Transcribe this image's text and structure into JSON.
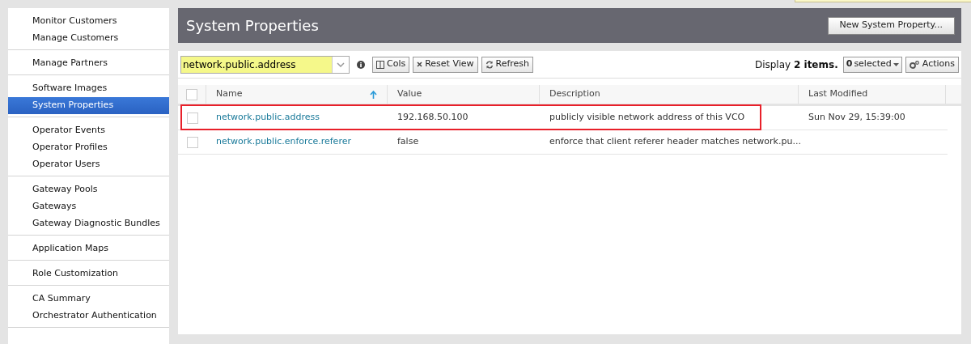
{
  "sidebar": {
    "groups": [
      {
        "items": [
          {
            "label": "Monitor Customers",
            "selected": false
          },
          {
            "label": "Manage Customers",
            "selected": false
          }
        ]
      },
      {
        "items": [
          {
            "label": "Manage Partners",
            "selected": false
          }
        ]
      },
      {
        "items": [
          {
            "label": "Software Images",
            "selected": false
          },
          {
            "label": "System Properties",
            "selected": true
          }
        ]
      },
      {
        "items": [
          {
            "label": "Operator Events",
            "selected": false
          },
          {
            "label": "Operator Profiles",
            "selected": false
          },
          {
            "label": "Operator Users",
            "selected": false
          }
        ]
      },
      {
        "items": [
          {
            "label": "Gateway Pools",
            "selected": false
          },
          {
            "label": "Gateways",
            "selected": false
          },
          {
            "label": "Gateway Diagnostic Bundles",
            "selected": false
          }
        ]
      },
      {
        "items": [
          {
            "label": "Application Maps",
            "selected": false
          }
        ]
      },
      {
        "items": [
          {
            "label": "Role Customization",
            "selected": false
          }
        ]
      },
      {
        "items": [
          {
            "label": "CA Summary",
            "selected": false
          },
          {
            "label": "Orchestrator Authentication",
            "selected": false
          }
        ]
      }
    ]
  },
  "page": {
    "title": "System Properties",
    "new_button": "New System Property..."
  },
  "toolbar": {
    "search_value": "network.public.address",
    "buttons": [
      "Cols",
      "Reset View",
      "Refresh"
    ],
    "display_prefix": "Display",
    "display_count": "2 items.",
    "selected_count": "0",
    "selected_label": "selected",
    "actions": "Actions"
  },
  "table": {
    "select_all_checked": false,
    "columns": [
      {
        "label": "Name",
        "sorted": true
      },
      {
        "label": "Value",
        "sorted": false
      },
      {
        "label": "Description",
        "sorted": false
      },
      {
        "label": "Last Modified",
        "sorted": false
      }
    ],
    "rows": [
      {
        "checked": false,
        "highlighted": true,
        "cells": [
          "network.public.address",
          "192.168.50.100",
          "publicly visible network address of this VCO",
          "Sun Nov 29, 15:39:00"
        ]
      },
      {
        "checked": false,
        "highlighted": false,
        "cells": [
          "network.public.enforce.referer",
          "false",
          "enforce that client referer header matches network.pu...",
          ""
        ]
      }
    ]
  }
}
